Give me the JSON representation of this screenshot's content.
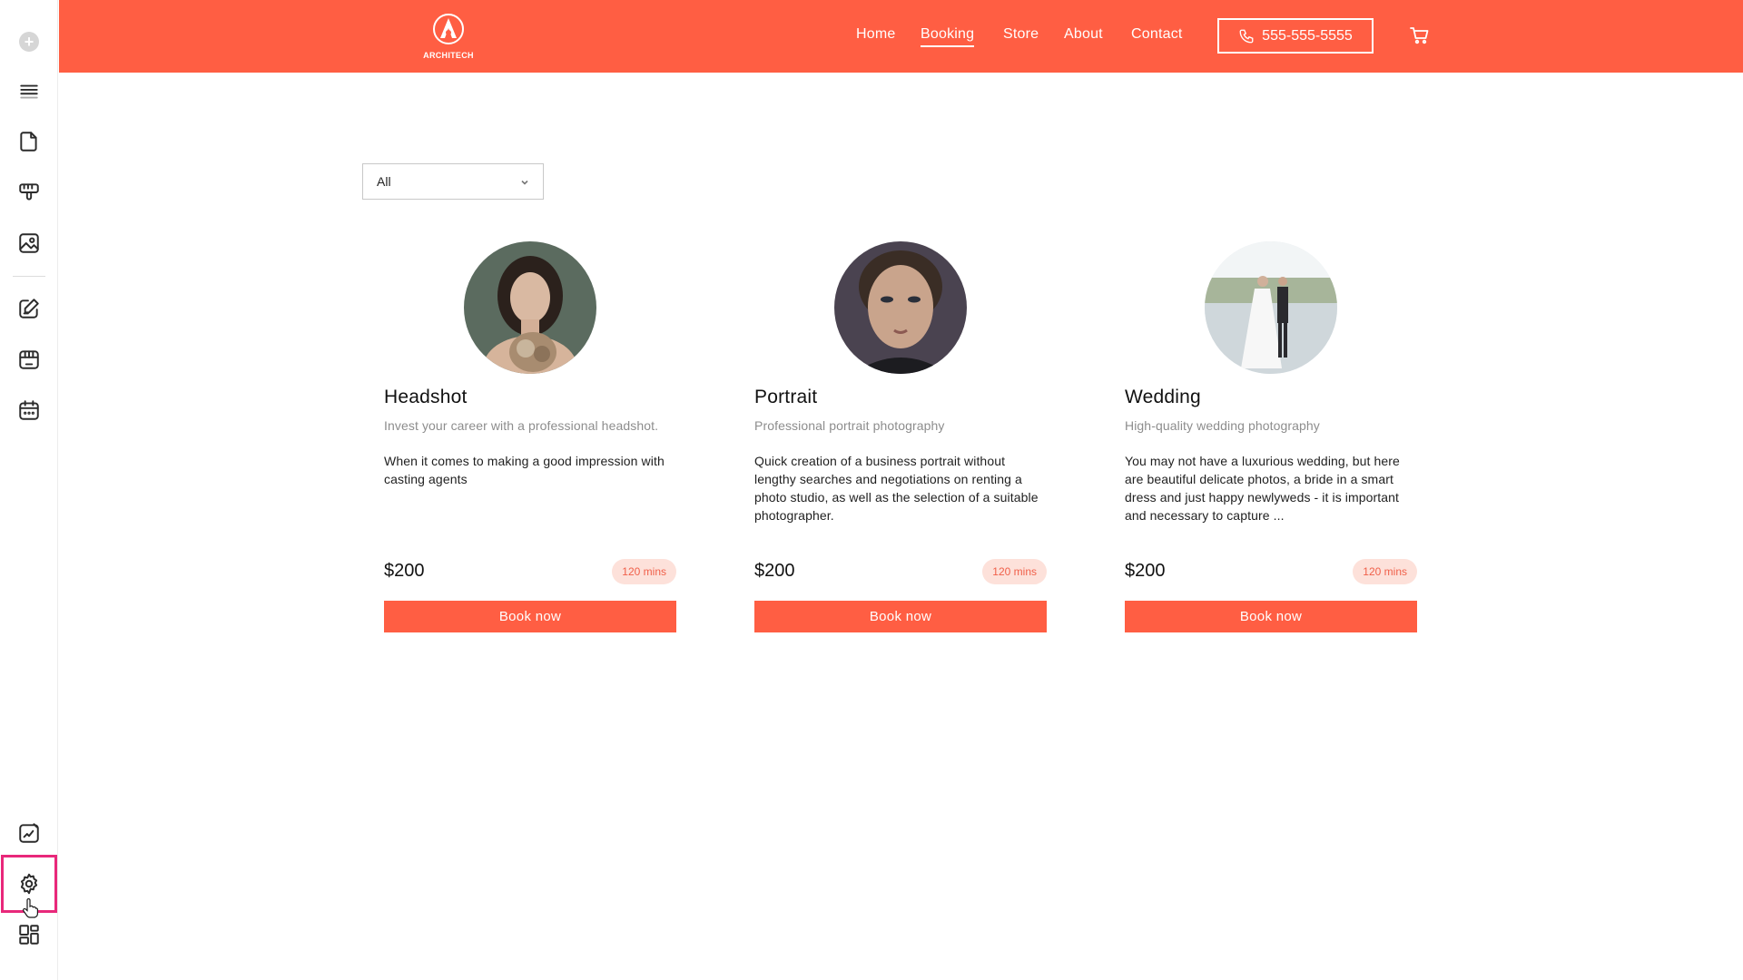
{
  "theme": {
    "accent": "#ff5e43",
    "badge_bg": "#fde1da",
    "badge_text": "#f0604a",
    "highlight": "#e8287a"
  },
  "editor_rail": {
    "items": [
      {
        "icon": "add-icon"
      },
      {
        "icon": "menu-layers-icon"
      },
      {
        "icon": "page-icon"
      },
      {
        "icon": "paint-roller-icon"
      },
      {
        "icon": "image-icon"
      },
      {
        "icon": "edit-icon"
      },
      {
        "icon": "store-icon"
      },
      {
        "icon": "calendar-icon"
      },
      {
        "icon": "design-edit-icon"
      },
      {
        "icon": "gear-icon",
        "selected": true
      },
      {
        "icon": "layout-grid-icon"
      }
    ]
  },
  "header": {
    "logo_text": "ARCHITECH",
    "nav": [
      {
        "label": "Home"
      },
      {
        "label": "Booking",
        "active": true
      },
      {
        "label": "Store"
      },
      {
        "label": "About"
      },
      {
        "label": "Contact"
      }
    ],
    "phone": "555-555-5555",
    "cart_icon": "cart-icon"
  },
  "filter": {
    "selected": "All"
  },
  "services": [
    {
      "title": "Headshot",
      "subtitle": "Invest your career with a professional headshot.",
      "description": "When it comes to making a good impression with casting agents",
      "price": "$200",
      "duration": "120 mins",
      "button": "Book now"
    },
    {
      "title": "Portrait",
      "subtitle": "Professional portrait photography",
      "description": "Quick creation of a business portrait without lengthy searches and negotiations on renting a photo studio, as well as the selection of a suitable photographer.",
      "price": "$200",
      "duration": "120 mins",
      "button": "Book now"
    },
    {
      "title": "Wedding",
      "subtitle": "High-quality wedding photography",
      "description": "You may not have a luxurious wedding, but here are beautiful delicate photos, a bride in a smart dress and just happy newlyweds - it is important and necessary to capture ...",
      "price": "$200",
      "duration": "120 mins",
      "button": "Book now"
    }
  ]
}
